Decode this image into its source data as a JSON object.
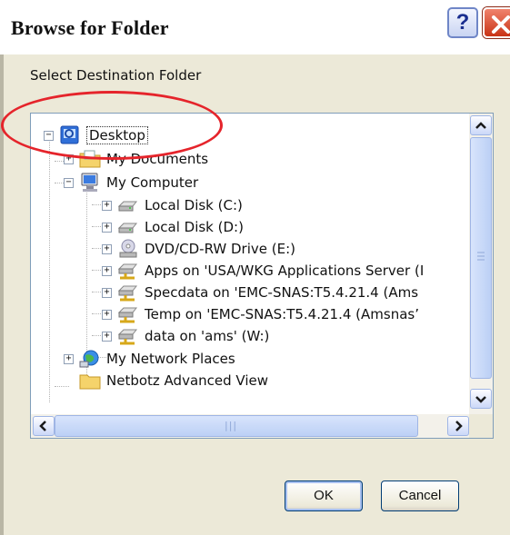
{
  "dialog": {
    "title": "Browse for Folder",
    "help_label": "?",
    "subtitle": "Select Destination Folder"
  },
  "tree": {
    "items": [
      {
        "label": "Desktop",
        "icon": "desktop-icon",
        "expander": "−",
        "selected": true
      },
      {
        "label": "My Documents",
        "icon": "folder-icon",
        "expander": "+"
      },
      {
        "label": "My Computer",
        "icon": "computer-icon",
        "expander": "−"
      },
      {
        "label": "Local Disk (C:)",
        "icon": "drive-icon",
        "expander": "+"
      },
      {
        "label": "Local Disk (D:)",
        "icon": "drive-icon",
        "expander": "+"
      },
      {
        "label": "DVD/CD-RW Drive (E:)",
        "icon": "cd-drive-icon",
        "expander": "+"
      },
      {
        "label": "Apps on 'USA/WKG Applications Server (I",
        "icon": "network-drive-icon",
        "expander": "+"
      },
      {
        "label": "Specdata on 'EMC-SNAS:T5.4.21.4 (Ams",
        "icon": "network-drive-icon",
        "expander": "+"
      },
      {
        "label": "Temp on 'EMC-SNAS:T5.4.21.4 (Amsnas’",
        "icon": "network-drive-icon",
        "expander": "+"
      },
      {
        "label": "data on 'ams' (W:)",
        "icon": "network-drive-icon",
        "expander": "+"
      },
      {
        "label": "My Network Places",
        "icon": "network-places-icon",
        "expander": "+"
      },
      {
        "label": "Netbotz Advanced View",
        "icon": "folder-icon",
        "expander": ""
      }
    ]
  },
  "scroll": {
    "grip": "|||"
  },
  "buttons": {
    "ok": "OK",
    "cancel": "Cancel"
  },
  "colors": {
    "annotation": "#e5242b",
    "titlebar_close": "#c93316",
    "tree_border": "#7f9db9"
  }
}
